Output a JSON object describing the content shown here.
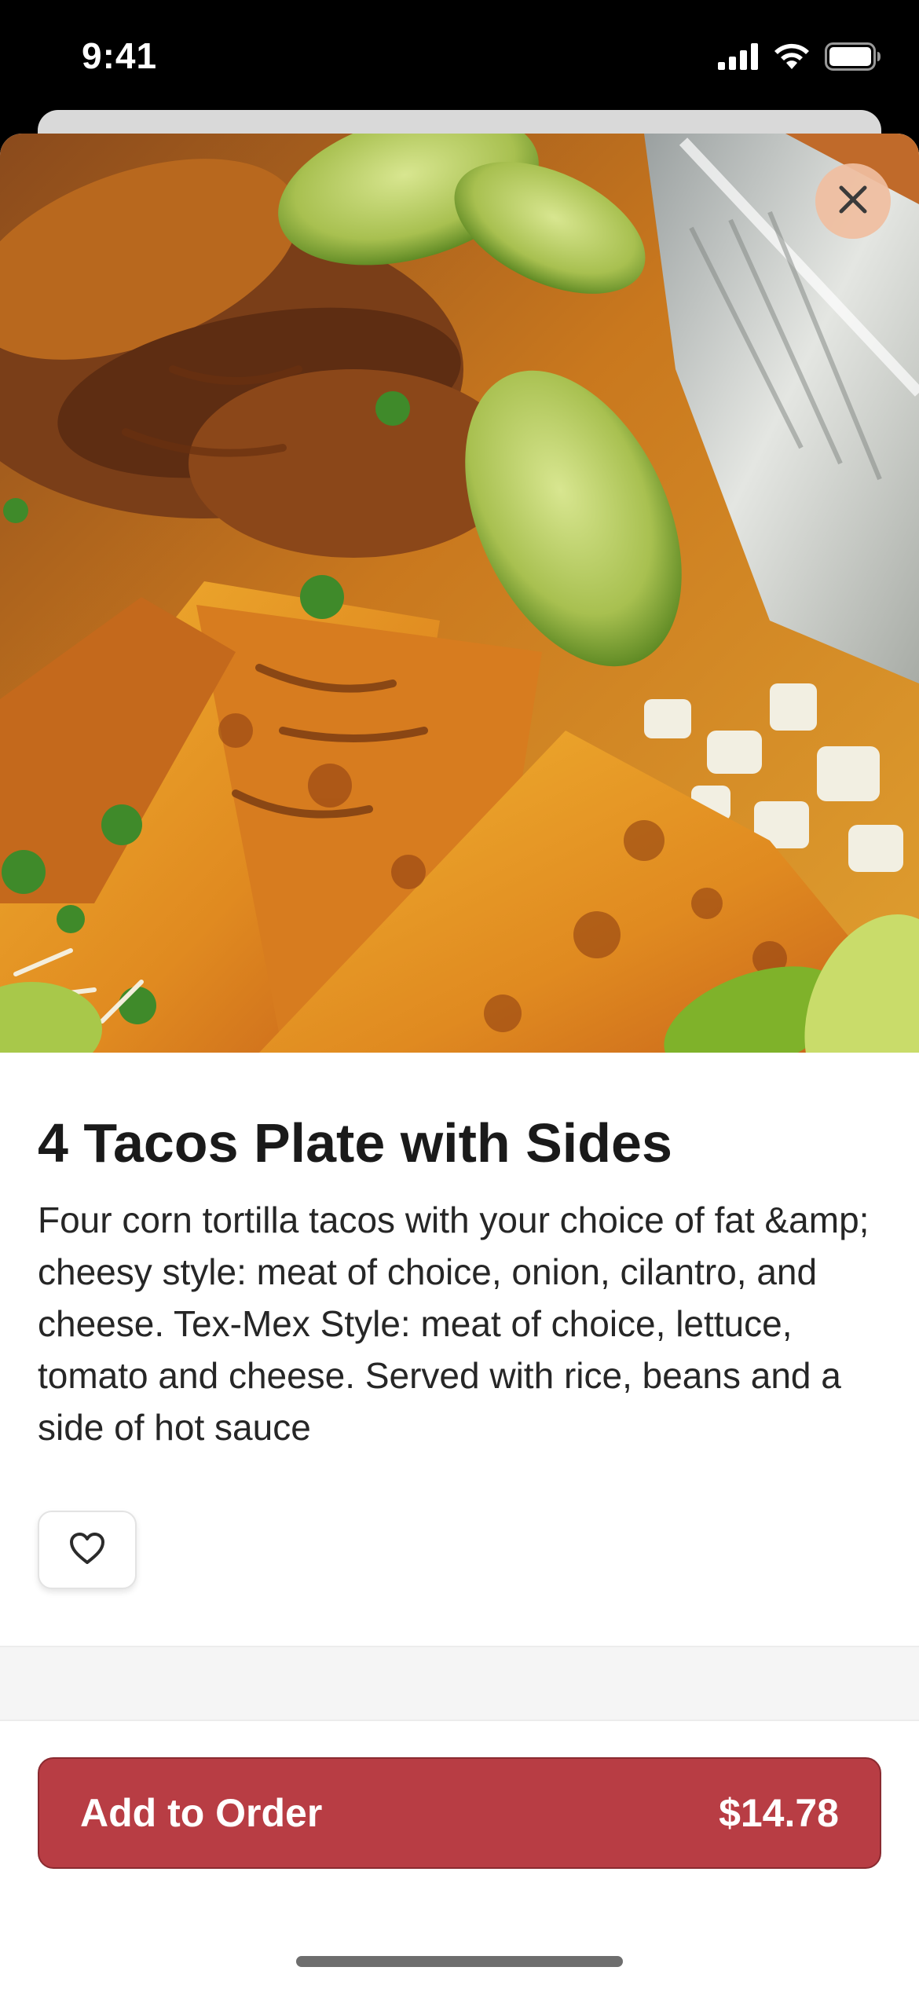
{
  "status_bar": {
    "time": "9:41",
    "signal_icon": "cellular-signal-icon",
    "wifi_icon": "wifi-icon",
    "battery_icon": "battery-icon"
  },
  "item": {
    "title": "4 Tacos Plate with Sides",
    "description": "Four corn tortilla tacos with your choice of fat &amp; cheesy style: meat of choice, onion, cilantro, and cheese. Tex-Mex Style: meat of choice, lettuce, tomato and cheese. Served with rice, beans and a side of hot sauce"
  },
  "actions": {
    "close_icon": "close-icon",
    "favorite_icon": "heart-icon",
    "add_label": "Add to Order",
    "price": "$14.78"
  },
  "colors": {
    "accent": "#b83d44",
    "close_bg": "#f0bea0"
  }
}
